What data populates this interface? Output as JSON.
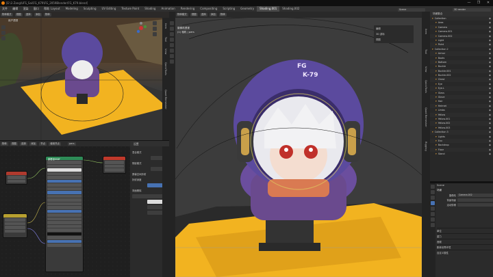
{
  "window": {
    "title": "[E:\\3 Zang\\UFS_Sai\\FG_K79\\FG_2059Blender\\FG_K79.blend]",
    "controls": [
      "—",
      "❐",
      "✕"
    ]
  },
  "menubar": {
    "items": [
      "文件",
      "编辑",
      "渲染",
      "窗口",
      "帮助"
    ],
    "workspaces": [
      "Layout",
      "Modeling",
      "Sculpting",
      "UV Editing",
      "Texture Paint",
      "Shading",
      "Animation",
      "Rendering",
      "Compositing",
      "Scripting",
      "Geometry",
      "Shading.001",
      "Shading.002"
    ],
    "active_workspace": "Shading.001",
    "scene_label": "Scene",
    "view_layer_label": "View Layer",
    "render_label": "3D render"
  },
  "viewport_small": {
    "header_buttons": [
      "物体模式",
      "视图",
      "选择",
      "添加",
      "物体"
    ],
    "overlay_label": "用户透视",
    "side_tabs": [
      "Item",
      "Tool",
      "View",
      "QuickTools",
      "Quad Remesher"
    ]
  },
  "node_editor": {
    "header_buttons": [
      "物体",
      "视图",
      "选择",
      "添加",
      "节点",
      "使用节点"
    ],
    "material_name": "pers",
    "principled_title": "原理化BSDF"
  },
  "props_mid": {
    "header": "设置",
    "rows": [
      "混合模式",
      "阴影模式",
      "屏幕空间折射",
      "折射深度",
      "背面剔除"
    ]
  },
  "viewport_main": {
    "header_buttons": [
      "物体模式",
      "视图",
      "选择",
      "添加",
      "物体"
    ],
    "overlay_line1": "摄像机透视",
    "overlay_line2": "(1) 相机 | pers",
    "side_menu": [
      "编辑",
      "3D 游标",
      "视图"
    ],
    "helmet_text": "K-79",
    "helmet_logo": "FG",
    "side_tabs": [
      "Item",
      "Tool",
      "View",
      "QuickTools",
      "Quad Remesher",
      "Rigging"
    ]
  },
  "outliner": {
    "title": "场景集合",
    "rows": [
      "Collection",
      "Area",
      "Camera",
      "Camera.001",
      "Camera.002",
      "Light",
      "Point",
      "Collection 2",
      "Armor",
      "Boots",
      "Bottom",
      "Buckle",
      "Buckle.001",
      "Buckle.002",
      "Chest",
      "Eye",
      "Eye.L",
      "Glass",
      "Glove",
      "Hair",
      "Helmet",
      "Limbs",
      "Yellow",
      "Yellow.001",
      "Yellow.002",
      "Yellow.003",
      "Collection 3",
      "Lights",
      "Env",
      "Backdrop",
      "Floor",
      "Stand"
    ]
  },
  "properties": {
    "header": "Scene",
    "scene_section": "场景",
    "camera_label": "摄像机",
    "camera_value": "Camera.002",
    "bg_scene_label": "背景场景",
    "active_clip_label": "活动剪辑",
    "sections": [
      "单位",
      "重力",
      "音频",
      "刚体世界环境",
      "自定义属性"
    ]
  },
  "colors": {
    "accent": "#4772b3",
    "active_tab": "#4a4a4a",
    "helmet_purple": "#5b4a9e",
    "floor_yellow": "#f2b320",
    "node_output": "#c0392b",
    "node_shader": "#2e8b57",
    "node_texture": "#b8a030"
  }
}
